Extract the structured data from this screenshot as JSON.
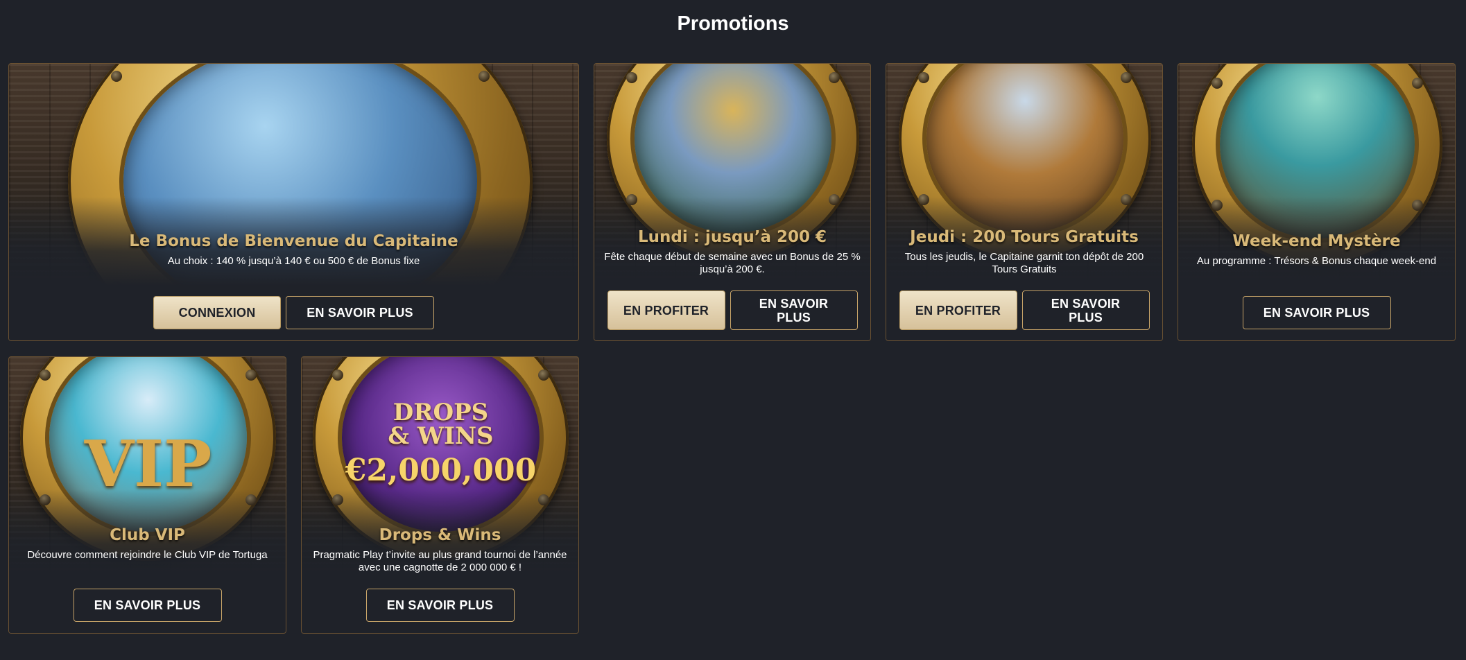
{
  "page": {
    "title": "Promotions"
  },
  "cards": [
    {
      "title": "Le Bonus de Bienvenue du Capitaine",
      "description": "Au choix : 140 % jusqu’à 140 € ou 500 € de Bonus fixe",
      "primary_button": "CONNEXION",
      "secondary_button": "EN SAVOIR PLUS"
    },
    {
      "title": "Lundi : jusqu’à 200 €",
      "description": "Fête chaque début de semaine avec un Bonus de 25 % jusqu’à 200 €.",
      "primary_button": "EN PROFITER",
      "secondary_button": "EN SAVOIR PLUS"
    },
    {
      "title": "Jeudi : 200 Tours Gratuits",
      "description": "Tous les jeudis, le Capitaine garnit ton dépôt de 200 Tours Gratuits",
      "primary_button": "EN PROFITER",
      "secondary_button": "EN SAVOIR PLUS"
    },
    {
      "title": "Week-end Mystère",
      "description": "Au programme : Trésors & Bonus chaque week-end",
      "secondary_button": "EN SAVOIR PLUS"
    },
    {
      "title": "Club VIP",
      "description": "Découvre comment rejoindre le Club VIP de Tortuga",
      "secondary_button": "EN SAVOIR PLUS",
      "image_text": "VIP"
    },
    {
      "title": "Drops & Wins",
      "description": "Pragmatic Play t’invite au plus grand tournoi de l’année avec une cagnotte de 2 000 000 € !",
      "secondary_button": "EN SAVOIR PLUS",
      "image_text_line1": "DROPS",
      "image_text_line2": "& WINS",
      "image_text_line3": "€2,000,000"
    }
  ],
  "colors": {
    "background": "#1f2229",
    "card_border": "#6b5232",
    "title_gold": "#d9b978",
    "button_primary": "#e6d6b4",
    "button_outline_border": "#c7a468"
  }
}
